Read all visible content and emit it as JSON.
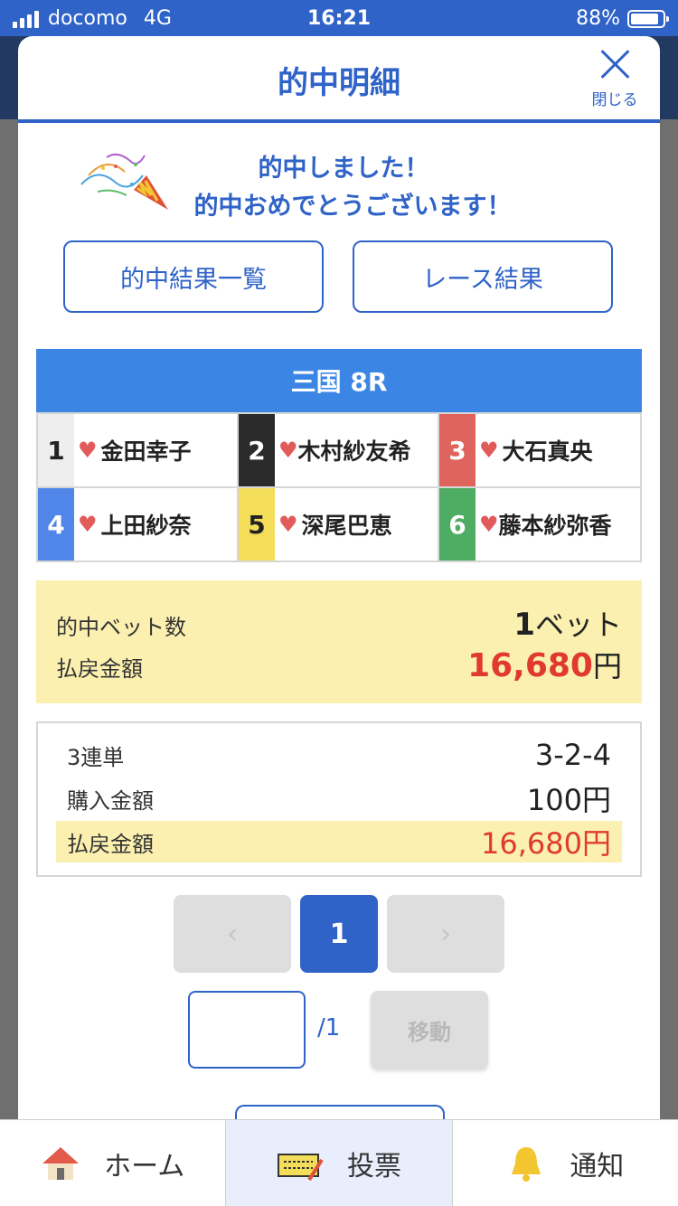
{
  "status_bar": {
    "carrier": "docomo",
    "network": "4G",
    "time": "16:21",
    "battery": "88%"
  },
  "modal": {
    "title": "的中明細",
    "close_label": "閉じる"
  },
  "congrats": {
    "line1": "的中しました！",
    "line2": "的中おめでとうございます！"
  },
  "buttons": {
    "hit_results": "的中結果一覧",
    "race_results": "レース結果"
  },
  "race": {
    "header": "三国 8R",
    "racers": [
      {
        "num": "1",
        "name": "金田幸子"
      },
      {
        "num": "2",
        "name": "木村紗友希"
      },
      {
        "num": "3",
        "name": "大石真央"
      },
      {
        "num": "4",
        "name": "上田紗奈"
      },
      {
        "num": "5",
        "name": "深尾巴恵"
      },
      {
        "num": "6",
        "name": "藤本紗弥香"
      }
    ]
  },
  "summary": {
    "bet_count_label": "的中ベット数",
    "bet_count_value": "1",
    "bet_count_unit": "ベット",
    "payout_label": "払戻金額",
    "payout_value": "16,680",
    "payout_unit": "円"
  },
  "detail": {
    "type_label": "3連単",
    "type_value": "3-2-4",
    "purchase_label": "購入金額",
    "purchase_value": "100円",
    "payout_label": "払戻金額",
    "payout_value": "16,680円"
  },
  "pager": {
    "prev": "‹",
    "current": "1",
    "next": "›"
  },
  "jump": {
    "input_value": "",
    "total": "/1",
    "button": "移動"
  },
  "tabbar": {
    "home": "ホーム",
    "vote": "投票",
    "notify": "通知"
  },
  "colors": {
    "primary": "#2f63c8",
    "race_header": "#3b86e5",
    "highlight": "#fbf0b0",
    "payout_red": "#e03a2e"
  },
  "icons": {
    "close": "close-icon",
    "party": "party-popper-icon",
    "heart": "heart-icon",
    "home": "home-icon",
    "vote": "ticket-icon",
    "notify": "bell-icon"
  }
}
